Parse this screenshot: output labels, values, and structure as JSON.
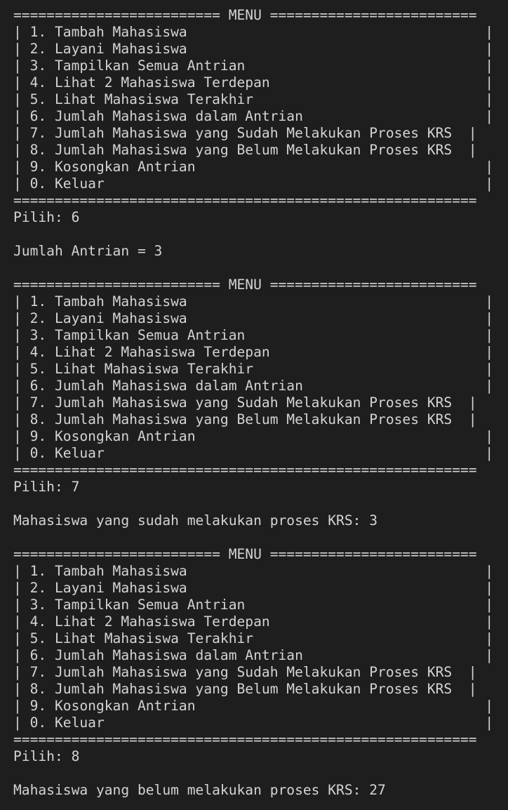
{
  "terminal": {
    "menu_header": "========================= MENU =========================",
    "menu_items": [
      "| 1. Tambah Mahasiswa                                    |",
      "| 2. Layani Mahasiswa                                    |",
      "| 3. Tampilkan Semua Antrian                             |",
      "| 4. Lihat 2 Mahasiswa Terdepan                          |",
      "| 5. Lihat Mahasiswa Terakhir                            |",
      "| 6. Jumlah Mahasiswa dalam Antrian                      |",
      "| 7. Jumlah Mahasiswa yang Sudah Melakukan Proses KRS  |",
      "| 8. Jumlah Mahasiswa yang Belum Melakukan Proses KRS  |",
      "| 9. Kosongkan Antrian                                   |",
      "| 0. Keluar                                              |"
    ],
    "menu_footer": "========================================================",
    "sessions": [
      {
        "prompt": "Pilih: 6",
        "result": "Jumlah Antrian = 3"
      },
      {
        "prompt": "Pilih: 7",
        "result": "Mahasiswa yang sudah melakukan proses KRS: 3"
      },
      {
        "prompt": "Pilih: 8",
        "result": "Mahasiswa yang belum melakukan proses KRS: 27"
      }
    ]
  }
}
